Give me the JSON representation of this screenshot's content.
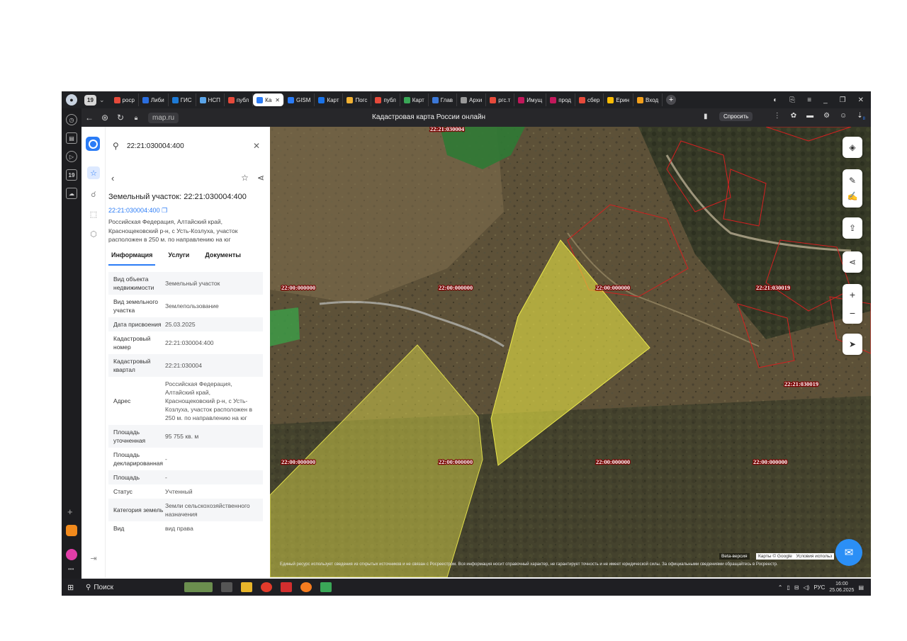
{
  "browser": {
    "tab_count": "19",
    "tabs": [
      {
        "label": "роср",
        "color": "#e64a3b"
      },
      {
        "label": "Либи",
        "color": "#2a6ee0"
      },
      {
        "label": "ГИС",
        "color": "#1d7ad6"
      },
      {
        "label": "НСП",
        "color": "#5aa4e8"
      },
      {
        "label": "публ",
        "color": "#e64a3b"
      },
      {
        "label": "Ка",
        "color": "#2b7cf6"
      },
      {
        "label": "GISM",
        "color": "#2b7cf6"
      },
      {
        "label": "Карт",
        "color": "#1a73e8"
      },
      {
        "label": "Погс",
        "color": "#f2b233"
      },
      {
        "label": "публ",
        "color": "#e64a3b"
      },
      {
        "label": "Карт",
        "color": "#3aa757"
      },
      {
        "label": "Глав",
        "color": "#3c78d8"
      },
      {
        "label": "Архи",
        "color": "#999999"
      },
      {
        "label": "ргс.т",
        "color": "#e64a3b"
      },
      {
        "label": "Имущ",
        "color": "#c2185b"
      },
      {
        "label": "прод",
        "color": "#c2185b"
      },
      {
        "label": "сбер",
        "color": "#e64a3b"
      },
      {
        "label": "Ерин",
        "color": "#fbbc04"
      },
      {
        "label": "Вход",
        "color": "#f2a01b"
      }
    ],
    "url": "map.ru",
    "page_title": "Кадастровая карта России онлайн",
    "ask_label": "Спросить",
    "download_badge": "8"
  },
  "search": {
    "value": "22:21:030004:400"
  },
  "parcel": {
    "title": "Земельный участок: 22:21:030004:400",
    "number_link": "22:21:030004:400",
    "address_text": "Российская Федерация, Алтайский край, Краснощековский р-н, с Усть-Козлуха, участок расположен в 250 м. по направлению на юг",
    "tabs": [
      "Информация",
      "Услуги",
      "Документы"
    ],
    "fields": [
      {
        "key": "Вид объекта недвижимости",
        "value": "Земельный участок"
      },
      {
        "key": "Вид земельного участка",
        "value": "Землепользование"
      },
      {
        "key": "Дата присвоения",
        "value": "25.03.2025"
      },
      {
        "key": "Кадастровый номер",
        "value": "22:21:030004:400"
      },
      {
        "key": "Кадастровый квартал",
        "value": "22:21:030004"
      },
      {
        "key": "Адрес",
        "value": "Российская Федерация, Алтайский край, Краснощековский р-н, с Усть-Козлуха, участок расположен в 250 м. по направлению на юг"
      },
      {
        "key": "Площадь уточненная",
        "value": "95 755 кв. м"
      },
      {
        "key": "Площадь декларированная",
        "value": "-"
      },
      {
        "key": "Площадь",
        "value": "-"
      },
      {
        "key": "Статус",
        "value": "Учтенный"
      },
      {
        "key": "Категория земель",
        "value": "Земли сельскохозяйственного назначения"
      },
      {
        "key": "Вид",
        "value": "вид права"
      }
    ]
  },
  "map": {
    "labels": {
      "l1": "22:00:000000",
      "l2": "22:00:000000",
      "l3": "22:00:000000",
      "l4": "22:21:030019",
      "l5": "22:00:000000",
      "l6": "22:00:000000",
      "l7": "22:00:000000",
      "l8": "22:00:000000",
      "l9": "22:21:030019",
      "l10": "22:21:030004"
    },
    "beta_label": "Beta-версия",
    "google_label": "Карты © Google",
    "terms_label": "Условия использ",
    "attribution": "Единый ресурс использует сведения из открытых источников и не связан с Росреестром. Вся информация носит справочный характер, не гарантирует точность и не имеет юридической силы. За официальными сведениями обращайтесь в Росреестр."
  },
  "taskbar": {
    "search_label": "Поиск",
    "lang": "РУС",
    "time": "16:00",
    "date": "25.06.2025"
  },
  "colors": {
    "parcel_fill": "#e8e545",
    "boundary": "#d42020",
    "accent": "#2b7cf6"
  }
}
